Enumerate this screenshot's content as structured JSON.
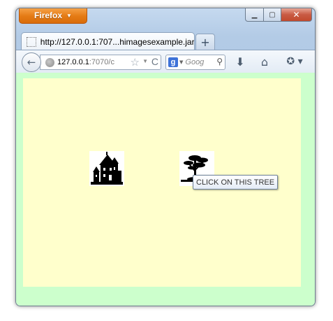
{
  "browser": {
    "menu_button": "Firefox",
    "menu_arrow": "▼",
    "window_controls": {
      "minimize": "▁",
      "maximize": "▢",
      "close": "✕"
    },
    "tab": {
      "title": "http://127.0.0.1:707...himagesexample.jar/"
    },
    "new_tab": "+",
    "nav": {
      "back": "←",
      "url_host": "127.0.0.1",
      "url_rest": ":7070/c",
      "star": "☆",
      "dropdown": "▼",
      "reload": "C",
      "search_engine": "g",
      "search_engine_drop": "▼",
      "search_placeholder": "Goog",
      "search_icon": "⚲",
      "download": "⬇",
      "home": "⌂",
      "bookmarks": "✪ ▾"
    }
  },
  "applet": {
    "images": [
      {
        "name": "castle",
        "icon": "castle-icon"
      },
      {
        "name": "tree",
        "icon": "tree-icon"
      }
    ],
    "tooltip": "CLICK ON THIS TREE"
  },
  "colors": {
    "page_background": "#ccffcc",
    "applet_background": "#ffffcc",
    "firefox_orange": "#e57b15"
  }
}
